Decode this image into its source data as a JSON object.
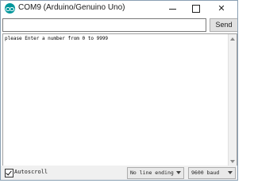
{
  "window": {
    "title": "COM9 (Arduino/Genuino Uno)",
    "app_icon": "arduino-icon"
  },
  "controls": {
    "minimize": "minimize-icon",
    "maximize": "maximize-icon",
    "close": "close-icon",
    "close_glyph": "✕"
  },
  "input": {
    "value": "",
    "send_label": "Send"
  },
  "output": {
    "lines": [
      "please Enter a number from 0 to 9999"
    ]
  },
  "footer": {
    "autoscroll_label": "Autoscroll",
    "autoscroll_checked": true,
    "line_ending": "No line ending",
    "baud_rate": "9600 baud"
  }
}
